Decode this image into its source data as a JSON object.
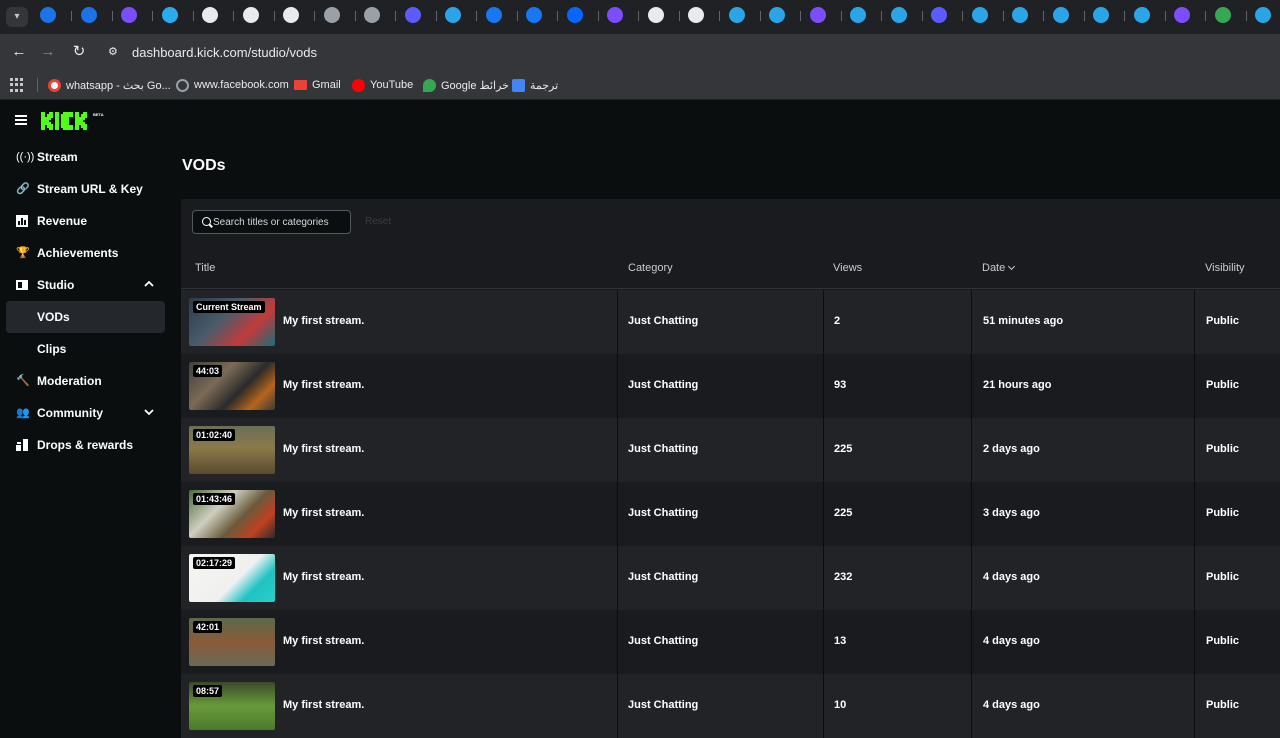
{
  "browser": {
    "url": "dashboard.kick.com/studio/vods",
    "bookmarks": [
      {
        "label": "whatsapp - بحث Go...",
        "icon": "google-icon",
        "color": "#ea4335"
      },
      {
        "label": "www.facebook.com",
        "icon": "globe-icon",
        "color": "#9aa0a6"
      },
      {
        "label": "Gmail",
        "icon": "gmail-icon",
        "color": "#ea4335"
      },
      {
        "label": "YouTube",
        "icon": "youtube-icon",
        "color": "#ff0000"
      },
      {
        "label": "Google خرائط",
        "icon": "maps-icon",
        "color": "#34a853"
      },
      {
        "label": "ترجمة",
        "icon": "translate-icon",
        "color": "#4285f4"
      }
    ]
  },
  "brand": {
    "accent": "#53fc18"
  },
  "sidebar": {
    "items": [
      {
        "label": "Stream",
        "icon": "broadcast-icon"
      },
      {
        "label": "Stream URL & Key",
        "icon": "link-icon"
      },
      {
        "label": "Revenue",
        "icon": "chart-icon"
      },
      {
        "label": "Achievements",
        "icon": "trophy-icon"
      },
      {
        "label": "Studio",
        "icon": "studio-icon",
        "expanded": true
      },
      {
        "label": "VODs",
        "active": true
      },
      {
        "label": "Clips"
      },
      {
        "label": "Moderation",
        "icon": "hammer-icon"
      },
      {
        "label": "Community",
        "icon": "users-icon",
        "expanded": false
      },
      {
        "label": "Drops & rewards",
        "icon": "gift-icon"
      }
    ]
  },
  "page": {
    "title": "VODs"
  },
  "search": {
    "placeholder": "Search titles or categories",
    "reset_label": "Reset"
  },
  "table": {
    "columns": [
      "Title",
      "Category",
      "Views",
      "Date",
      "Visibility"
    ],
    "rows": [
      {
        "badge": "Current Stream",
        "title": "My first stream.",
        "category": "Just Chatting",
        "views": "2",
        "date": "51 minutes ago",
        "visibility": "Public"
      },
      {
        "badge": "44:03",
        "title": "My first stream.",
        "category": "Just Chatting",
        "views": "93",
        "date": "21 hours ago",
        "visibility": "Public"
      },
      {
        "badge": "01:02:40",
        "title": "My first stream.",
        "category": "Just Chatting",
        "views": "225",
        "date": "2 days ago",
        "visibility": "Public"
      },
      {
        "badge": "01:43:46",
        "title": "My first stream.",
        "category": "Just Chatting",
        "views": "225",
        "date": "3 days ago",
        "visibility": "Public"
      },
      {
        "badge": "02:17:29",
        "title": "My first stream.",
        "category": "Just Chatting",
        "views": "232",
        "date": "4 days ago",
        "visibility": "Public"
      },
      {
        "badge": "42:01",
        "title": "My first stream.",
        "category": "Just Chatting",
        "views": "13",
        "date": "4 days ago",
        "visibility": "Public"
      },
      {
        "badge": "08:57",
        "title": "My first stream.",
        "category": "Just Chatting",
        "views": "10",
        "date": "4 days ago",
        "visibility": "Public"
      }
    ]
  }
}
